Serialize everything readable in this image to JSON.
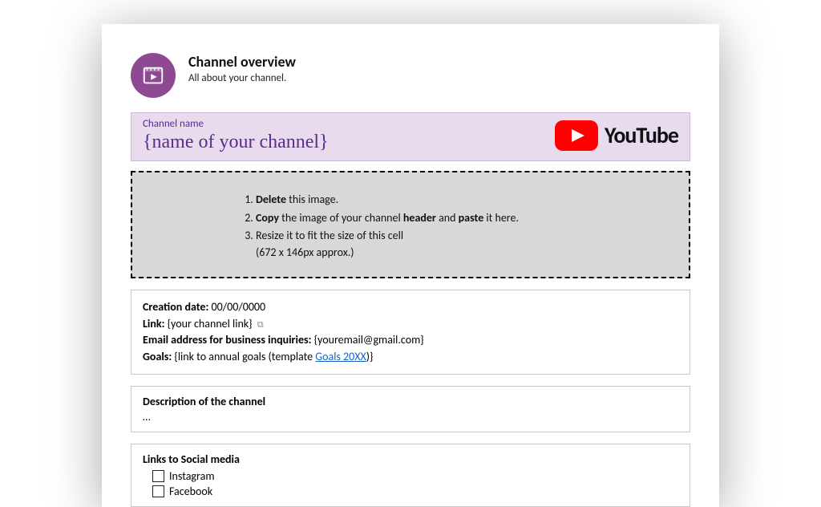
{
  "header": {
    "title": "Channel overview",
    "subtitle": "All about your channel."
  },
  "channel": {
    "label": "Channel name",
    "value": "{name of your channel}",
    "platform": "YouTube"
  },
  "instructions": [
    {
      "before": "",
      "bold": "Delete",
      "after": " this image."
    },
    {
      "before": "",
      "bold": "Copy",
      "after": " the image of your channel ",
      "bold2": "header",
      "after2": " and ",
      "bold3": "paste",
      "after3": " it here."
    },
    {
      "before": "Resize it to fit the size of this cell",
      "bold": "",
      "after": ""
    }
  ],
  "instruction_tail": "(672 x 146px approx.)",
  "meta": {
    "creation_label": "Creation date:",
    "creation_value": "00/00/0000",
    "link_label": "Link:",
    "link_value": "{your channel link}",
    "email_label": "Email address for business inquiries:",
    "email_value": "{youremail@gmail.com}",
    "goals_label": "Goals:",
    "goals_before": "{link to annual goals (template ",
    "goals_link": "  Goals 20XX",
    "goals_after": ")}"
  },
  "description": {
    "heading": "Description of the channel",
    "body": "…"
  },
  "social": {
    "heading": "Links to Social media",
    "items": [
      "Instagram",
      "Facebook"
    ]
  }
}
